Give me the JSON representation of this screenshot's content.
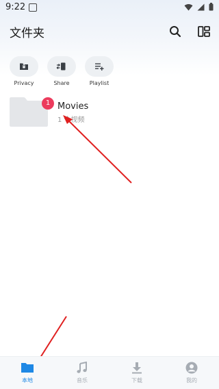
{
  "status_bar": {
    "time": "9:22",
    "icons": [
      "notification-icon",
      "wifi-icon",
      "cell-signal-icon",
      "battery-icon"
    ]
  },
  "header": {
    "title": "文件夹",
    "search_icon": "search-icon",
    "layout_icon": "layout-toggle-icon"
  },
  "actions": [
    {
      "label": "Privacy",
      "icon": "privacy-folder-icon"
    },
    {
      "label": "Share",
      "icon": "share-icon"
    },
    {
      "label": "Playlist",
      "icon": "playlist-add-icon"
    }
  ],
  "folders": [
    {
      "name": "Movies",
      "count": "1 个视频",
      "badge": "1",
      "icon": "folder-icon"
    }
  ],
  "bottom_nav": [
    {
      "label": "本地",
      "icon": "folder-icon",
      "active": true
    },
    {
      "label": "音乐",
      "icon": "music-note-icon",
      "active": false
    },
    {
      "label": "下载",
      "icon": "download-icon",
      "active": false
    },
    {
      "label": "我的",
      "icon": "profile-icon",
      "active": false
    }
  ],
  "colors": {
    "accent": "#1e88e5",
    "badge": "#ec3b5d",
    "annotation_arrow": "#e02020",
    "inactive": "#a6acb3"
  }
}
